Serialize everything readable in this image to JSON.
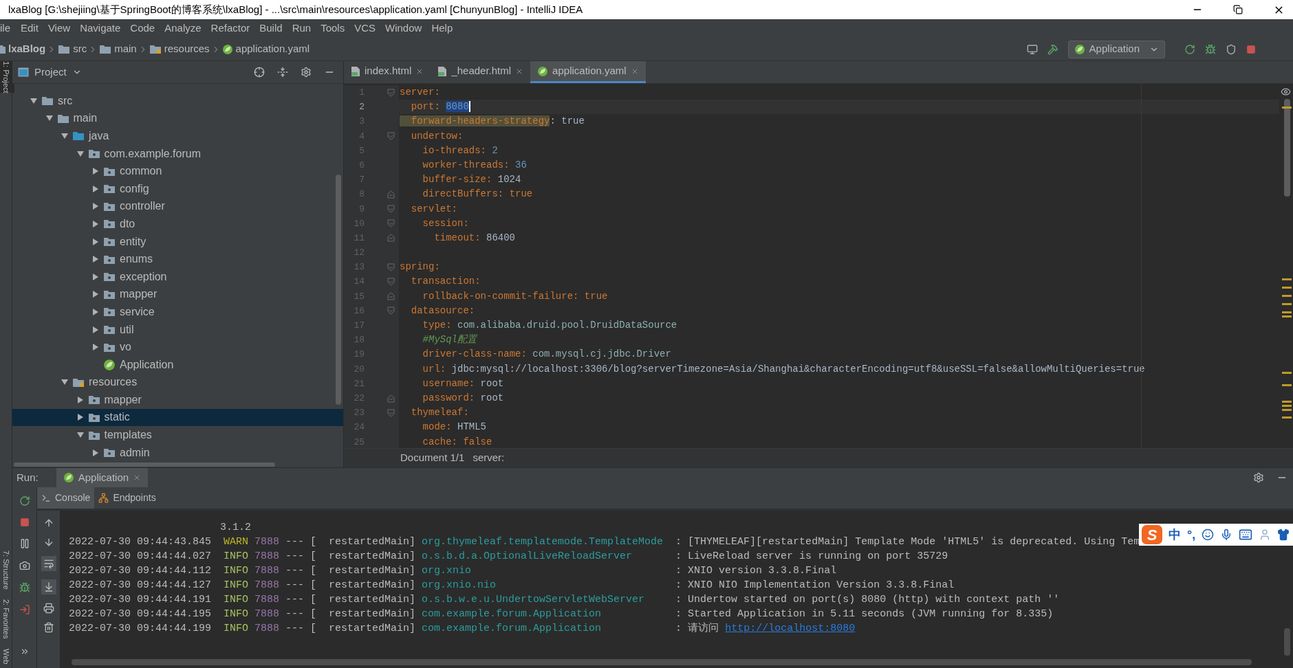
{
  "window": {
    "title": "lxaBlog [G:\\shejiing\\基于SpringBoot的博客系统\\lxaBlog] - ...\\src\\main\\resources\\application.yaml [ChunyunBlog] - IntelliJ IDEA"
  },
  "menu": [
    "ile",
    "Edit",
    "View",
    "Navigate",
    "Code",
    "Analyze",
    "Refactor",
    "Build",
    "Run",
    "Tools",
    "VCS",
    "Window",
    "Help"
  ],
  "breadcrumbs": [
    {
      "label": "lxaBlog",
      "kind": "project"
    },
    {
      "label": "src",
      "kind": "folder"
    },
    {
      "label": "main",
      "kind": "folder"
    },
    {
      "label": "resources",
      "kind": "resources"
    },
    {
      "label": "application.yaml",
      "kind": "yaml"
    }
  ],
  "run_config": {
    "label": "Application"
  },
  "left_stripe": {
    "top": [
      {
        "label": "1: Project",
        "selected": true
      }
    ],
    "bottom": [
      {
        "label": "7: Structure",
        "selected": false
      },
      {
        "label": "2: Favorites",
        "selected": false
      },
      {
        "label": "Web",
        "selected": false
      }
    ]
  },
  "project": {
    "title": "Project",
    "tree": [
      {
        "label": "src",
        "kind": "folder",
        "expanded": true,
        "selected": false,
        "children": [
          {
            "label": "main",
            "kind": "folder",
            "expanded": true,
            "selected": false,
            "children": [
              {
                "label": "java",
                "kind": "source",
                "expanded": true,
                "selected": false,
                "children": [
                  {
                    "label": "com.example.forum",
                    "kind": "package",
                    "expanded": true,
                    "selected": false,
                    "children": [
                      {
                        "label": "common",
                        "kind": "package",
                        "expanded": false,
                        "selected": false
                      },
                      {
                        "label": "config",
                        "kind": "package",
                        "expanded": false,
                        "selected": false
                      },
                      {
                        "label": "controller",
                        "kind": "package",
                        "expanded": false,
                        "selected": false
                      },
                      {
                        "label": "dto",
                        "kind": "package",
                        "expanded": false,
                        "selected": false
                      },
                      {
                        "label": "entity",
                        "kind": "package",
                        "expanded": false,
                        "selected": false
                      },
                      {
                        "label": "enums",
                        "kind": "package",
                        "expanded": false,
                        "selected": false
                      },
                      {
                        "label": "exception",
                        "kind": "package",
                        "expanded": false,
                        "selected": false
                      },
                      {
                        "label": "mapper",
                        "kind": "package",
                        "expanded": false,
                        "selected": false
                      },
                      {
                        "label": "service",
                        "kind": "package",
                        "expanded": false,
                        "selected": false
                      },
                      {
                        "label": "util",
                        "kind": "package",
                        "expanded": false,
                        "selected": false
                      },
                      {
                        "label": "vo",
                        "kind": "package",
                        "expanded": false,
                        "selected": false
                      },
                      {
                        "label": "Application",
                        "kind": "class",
                        "selected": false
                      }
                    ]
                  }
                ]
              },
              {
                "label": "resources",
                "kind": "resources",
                "expanded": true,
                "selected": false,
                "children": [
                  {
                    "label": "mapper",
                    "kind": "package",
                    "expanded": false,
                    "selected": false
                  },
                  {
                    "label": "static",
                    "kind": "package",
                    "expanded": false,
                    "selected": true
                  },
                  {
                    "label": "templates",
                    "kind": "package",
                    "expanded": true,
                    "selected": false,
                    "children": [
                      {
                        "label": "admin",
                        "kind": "package",
                        "expanded": false,
                        "selected": false
                      }
                    ]
                  }
                ]
              }
            ]
          }
        ]
      }
    ]
  },
  "editor": {
    "tabs": [
      {
        "label": "index.html",
        "kind": "html",
        "selected": false
      },
      {
        "label": "_header.html",
        "kind": "html",
        "selected": false
      },
      {
        "label": "application.yaml",
        "kind": "yaml",
        "selected": true
      }
    ],
    "lines": [
      {
        "number": "1",
        "key": "server:",
        "kind": "key",
        "fold_start": true,
        "fold_end": false,
        "current": false,
        "warning": false,
        "selected": false
      },
      {
        "number": "2",
        "key": "  port:",
        "value": "8080",
        "kind": "number",
        "fold_start": false,
        "fold_end": false,
        "current": true,
        "warning": false,
        "selected": true
      },
      {
        "number": "3",
        "key": "  forward-headers-strategy",
        "colon": ":",
        "value": "true",
        "kind": "text",
        "fold_start": false,
        "fold_end": false,
        "current": false,
        "warning": true,
        "selected": false
      },
      {
        "number": "4",
        "key": "  undertow:",
        "kind": "key",
        "fold_start": true,
        "fold_end": false,
        "current": false,
        "warning": false,
        "selected": false
      },
      {
        "number": "5",
        "key": "    io-threads:",
        "value": "2",
        "kind": "number",
        "fold_start": false,
        "fold_end": false,
        "current": false,
        "warning": false,
        "selected": false
      },
      {
        "number": "6",
        "key": "    worker-threads:",
        "value": "36",
        "kind": "number",
        "fold_start": false,
        "fold_end": false,
        "current": false,
        "warning": false,
        "selected": false
      },
      {
        "number": "7",
        "key": "    buffer-size:",
        "value": "1024",
        "kind": "text",
        "fold_start": false,
        "fold_end": false,
        "current": false,
        "warning": false,
        "selected": false
      },
      {
        "number": "8",
        "key": "    directBuffers:",
        "value": "true",
        "kind": "keyword",
        "fold_start": false,
        "fold_end": true,
        "current": false,
        "warning": false,
        "selected": false
      },
      {
        "number": "9",
        "key": "  servlet:",
        "kind": "key",
        "fold_start": true,
        "fold_end": false,
        "current": false,
        "warning": false,
        "selected": false
      },
      {
        "number": "10",
        "key": "    session:",
        "kind": "key",
        "fold_start": true,
        "fold_end": false,
        "current": false,
        "warning": false,
        "selected": false
      },
      {
        "number": "11",
        "key": "      timeout:",
        "value": "86400",
        "kind": "text",
        "fold_start": false,
        "fold_end": true,
        "current": false,
        "warning": false,
        "selected": false
      },
      {
        "number": "12",
        "kind": "blank",
        "fold_start": false,
        "fold_end": false,
        "current": false,
        "warning": false,
        "selected": false
      },
      {
        "number": "13",
        "key": "spring:",
        "kind": "key",
        "fold_start": true,
        "fold_end": false,
        "current": false,
        "warning": false,
        "selected": false
      },
      {
        "number": "14",
        "key": "  transaction:",
        "kind": "key",
        "fold_start": true,
        "fold_end": false,
        "current": false,
        "warning": false,
        "selected": false
      },
      {
        "number": "15",
        "key": "    rollback-on-commit-failure:",
        "value": "true",
        "kind": "keyword",
        "fold_start": false,
        "fold_end": true,
        "current": false,
        "warning": false,
        "selected": false
      },
      {
        "number": "16",
        "key": "  datasource:",
        "kind": "key",
        "fold_start": true,
        "fold_end": false,
        "current": false,
        "warning": false,
        "selected": false
      },
      {
        "number": "17",
        "key": "    type:",
        "value": "com.alibaba.druid.pool.DruidDataSource",
        "kind": "class",
        "fold_start": false,
        "fold_end": false,
        "current": false,
        "warning": false,
        "selected": false
      },
      {
        "number": "18",
        "comment": "    #MySql配置",
        "kind": "comment",
        "fold_start": false,
        "fold_end": false,
        "current": false,
        "warning": false,
        "selected": false
      },
      {
        "number": "19",
        "key": "    driver-class-name:",
        "value": "com.mysql.cj.jdbc.Driver",
        "kind": "class",
        "fold_start": false,
        "fold_end": false,
        "current": false,
        "warning": false,
        "selected": false
      },
      {
        "number": "20",
        "key": "    url:",
        "value": "jdbc:mysql://localhost:3306/blog?serverTimezone=Asia/Shanghai&characterEncoding=utf8&useSSL=false&allowMultiQueries=true",
        "kind": "text",
        "fold_start": false,
        "fold_end": false,
        "current": false,
        "warning": false,
        "selected": false
      },
      {
        "number": "21",
        "key": "    username:",
        "value": "root",
        "kind": "text",
        "fold_start": false,
        "fold_end": false,
        "current": false,
        "warning": false,
        "selected": false
      },
      {
        "number": "22",
        "key": "    password:",
        "value": "root",
        "kind": "text",
        "fold_start": false,
        "fold_end": true,
        "current": false,
        "warning": false,
        "selected": false
      },
      {
        "number": "23",
        "key": "  thymeleaf:",
        "kind": "key",
        "fold_start": true,
        "fold_end": false,
        "current": false,
        "warning": false,
        "selected": false
      },
      {
        "number": "24",
        "key": "    mode:",
        "value": "HTML5",
        "kind": "text",
        "fold_start": false,
        "fold_end": false,
        "current": false,
        "warning": false,
        "selected": false
      },
      {
        "number": "25",
        "key": "    cache:",
        "value": "false",
        "kind": "keyword",
        "fold_start": false,
        "fold_end": false,
        "current": false,
        "warning": false,
        "selected": false
      }
    ],
    "breadcrumb": [
      "Document 1/1",
      "server:"
    ]
  },
  "run": {
    "label": "Run:",
    "tab": {
      "label": "Application"
    },
    "subtabs": [
      {
        "label": "Console",
        "kind": "console",
        "selected": true
      },
      {
        "label": "Endpoints",
        "kind": "endpoints",
        "selected": false
      }
    ],
    "console": {
      "version": "3.1.2",
      "rows": [
        {
          "time": "2022-07-30 09:44:43.845",
          "level": "WARN",
          "kind": "warn",
          "pid": "7888",
          "sep": "---",
          "thread": "[  restartedMain]",
          "logger": "org.thymeleaf.templatemode.TemplateMode",
          "message": ": [THYMELEAF][restartedMain] Template Mode 'HTML5' is deprecated. Using Tem"
        },
        {
          "time": "2022-07-30 09:44:44.027",
          "level": "INFO",
          "kind": "info",
          "pid": "7888",
          "sep": "---",
          "thread": "[  restartedMain]",
          "logger": "o.s.b.d.a.OptionalLiveReloadServer",
          "message": ": LiveReload server is running on port 35729"
        },
        {
          "time": "2022-07-30 09:44:44.112",
          "level": "INFO",
          "kind": "info",
          "pid": "7888",
          "sep": "---",
          "thread": "[  restartedMain]",
          "logger": "org.xnio",
          "message": ": XNIO version 3.3.8.Final"
        },
        {
          "time": "2022-07-30 09:44:44.127",
          "level": "INFO",
          "kind": "info",
          "pid": "7888",
          "sep": "---",
          "thread": "[  restartedMain]",
          "logger": "org.xnio.nio",
          "message": ": XNIO NIO Implementation Version 3.3.8.Final"
        },
        {
          "time": "2022-07-30 09:44:44.191",
          "level": "INFO",
          "kind": "info",
          "pid": "7888",
          "sep": "---",
          "thread": "[  restartedMain]",
          "logger": "o.s.b.w.e.u.UndertowServletWebServer",
          "message": ": Undertow started on port(s) 8080 (http) with context path ''"
        },
        {
          "time": "2022-07-30 09:44:44.195",
          "level": "INFO",
          "kind": "info",
          "pid": "7888",
          "sep": "---",
          "thread": "[  restartedMain]",
          "logger": "com.example.forum.Application",
          "message": ": Started Application in 5.11 seconds (JVM running for 8.335)"
        },
        {
          "time": "2022-07-30 09:44:44.199",
          "level": "INFO",
          "kind": "info",
          "pid": "7888",
          "sep": "---",
          "thread": "[  restartedMain]",
          "logger": "com.example.forum.Application",
          "message": ": 请访问",
          "link": "http://localhost:8080"
        }
      ]
    }
  },
  "ime": {
    "logo": "S",
    "items": [
      "中",
      "°,"
    ]
  }
}
